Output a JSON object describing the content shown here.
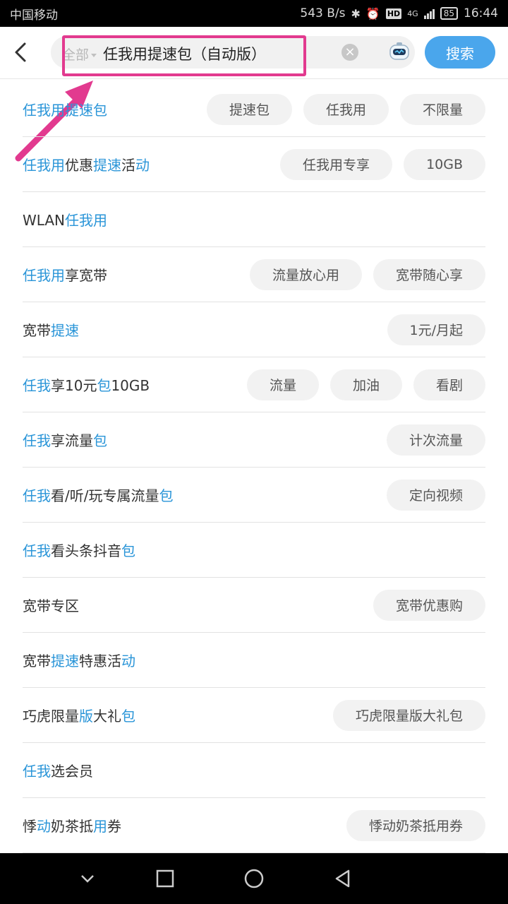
{
  "status": {
    "carrier": "中国移动",
    "speed": "543 B/s",
    "battery": "85",
    "time": "16:44",
    "network": "4G"
  },
  "search": {
    "scope": "全部",
    "query": "任我用提速包（自动版）",
    "button": "搜索"
  },
  "results": [
    {
      "title_parts": [
        {
          "t": "任我用",
          "hl": true
        },
        {
          "t": "提速包",
          "hl": true
        }
      ],
      "tags": [
        "提速包",
        "任我用",
        "不限量"
      ]
    },
    {
      "title_parts": [
        {
          "t": "任我用",
          "hl": true
        },
        {
          "t": "优惠",
          "hl": false
        },
        {
          "t": "提速",
          "hl": true
        },
        {
          "t": "活",
          "hl": false
        },
        {
          "t": "动",
          "hl": true
        }
      ],
      "tags": [
        "任我用专享",
        "10GB"
      ]
    },
    {
      "title_parts": [
        {
          "t": "WLAN",
          "hl": false
        },
        {
          "t": "任我用",
          "hl": true
        }
      ],
      "tags": []
    },
    {
      "title_parts": [
        {
          "t": "任我用",
          "hl": true
        },
        {
          "t": "享宽带",
          "hl": false
        }
      ],
      "tags": [
        "流量放心用",
        "宽带随心享"
      ]
    },
    {
      "title_parts": [
        {
          "t": "宽带",
          "hl": false
        },
        {
          "t": "提速",
          "hl": true
        }
      ],
      "tags": [
        "1元/月起"
      ]
    },
    {
      "title_parts": [
        {
          "t": "任我",
          "hl": true
        },
        {
          "t": "享10元",
          "hl": false
        },
        {
          "t": "包",
          "hl": true
        },
        {
          "t": "10GB",
          "hl": false
        }
      ],
      "tags": [
        "流量",
        "加油",
        "看剧"
      ]
    },
    {
      "title_parts": [
        {
          "t": "任我",
          "hl": true
        },
        {
          "t": "享流量",
          "hl": false
        },
        {
          "t": "包",
          "hl": true
        }
      ],
      "tags": [
        "计次流量"
      ]
    },
    {
      "title_parts": [
        {
          "t": "任我",
          "hl": true
        },
        {
          "t": "看/听/玩专属流量",
          "hl": false
        },
        {
          "t": "包",
          "hl": true
        }
      ],
      "tags": [
        "定向视频"
      ]
    },
    {
      "title_parts": [
        {
          "t": "任我",
          "hl": true
        },
        {
          "t": "看头条抖音",
          "hl": false
        },
        {
          "t": "包",
          "hl": true
        }
      ],
      "tags": []
    },
    {
      "title_parts": [
        {
          "t": "宽带专区",
          "hl": false
        }
      ],
      "tags": [
        "宽带优惠购"
      ]
    },
    {
      "title_parts": [
        {
          "t": "宽带",
          "hl": false
        },
        {
          "t": "提速",
          "hl": true
        },
        {
          "t": "特惠活",
          "hl": false
        },
        {
          "t": "动",
          "hl": true
        }
      ],
      "tags": []
    },
    {
      "title_parts": [
        {
          "t": "巧虎限量",
          "hl": false
        },
        {
          "t": "版",
          "hl": true
        },
        {
          "t": "大礼",
          "hl": false
        },
        {
          "t": "包",
          "hl": true
        }
      ],
      "tags": [
        "巧虎限量版大礼包"
      ]
    },
    {
      "title_parts": [
        {
          "t": "任我",
          "hl": true
        },
        {
          "t": "选会员",
          "hl": false
        }
      ],
      "tags": []
    },
    {
      "title_parts": [
        {
          "t": "悸",
          "hl": false
        },
        {
          "t": "动",
          "hl": true
        },
        {
          "t": "奶茶抵",
          "hl": false
        },
        {
          "t": "用",
          "hl": true
        },
        {
          "t": "券",
          "hl": false
        }
      ],
      "tags": [
        "悸动奶茶抵用券"
      ]
    }
  ],
  "colors": {
    "accent": "#4aa6ec",
    "highlight_text": "#2a95d8",
    "annotation": "#e23a8f"
  }
}
